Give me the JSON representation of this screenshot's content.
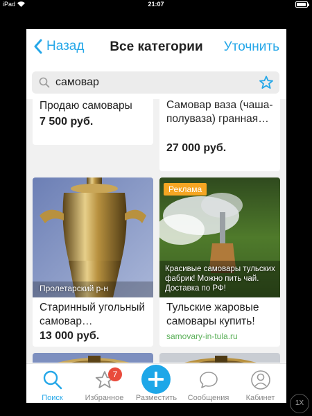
{
  "status_bar": {
    "device": "iPad",
    "time": "21:07",
    "battery_level": 0.9
  },
  "navbar": {
    "back_label": "Назад",
    "title": "Все категории",
    "refine_label": "Уточнить"
  },
  "search": {
    "value": "самовар",
    "placeholder": ""
  },
  "listings": [
    {
      "title": "Продаю самовары",
      "price": "7 500 руб."
    },
    {
      "title": "Самовар ваза (чаша-полуваза) гранная…",
      "price": "27 000 руб."
    },
    {
      "title": "Старинный угольный самовар…",
      "price": "13 000 руб.",
      "location": "Пролетарский р-н"
    }
  ],
  "ad": {
    "badge": "Реклама",
    "overlay_text": "Красивые самовары тульских фабрик! Можно пить чай. Доставка по РФ!",
    "title": "Тульские жаровые самовары купить!",
    "domain": "samovary-in-tula.ru"
  },
  "tabbar": {
    "search_label": "Поиск",
    "favorites_label": "Избранное",
    "favorites_count": "7",
    "post_label": "Разместить",
    "messages_label": "Сообщения",
    "cabinet_label": "Кабинет"
  },
  "zoom_label": "1X",
  "colors": {
    "accent": "#25a7e8",
    "badge": "#f5a623",
    "notification": "#e94b3c",
    "domain": "#5cb15a"
  }
}
